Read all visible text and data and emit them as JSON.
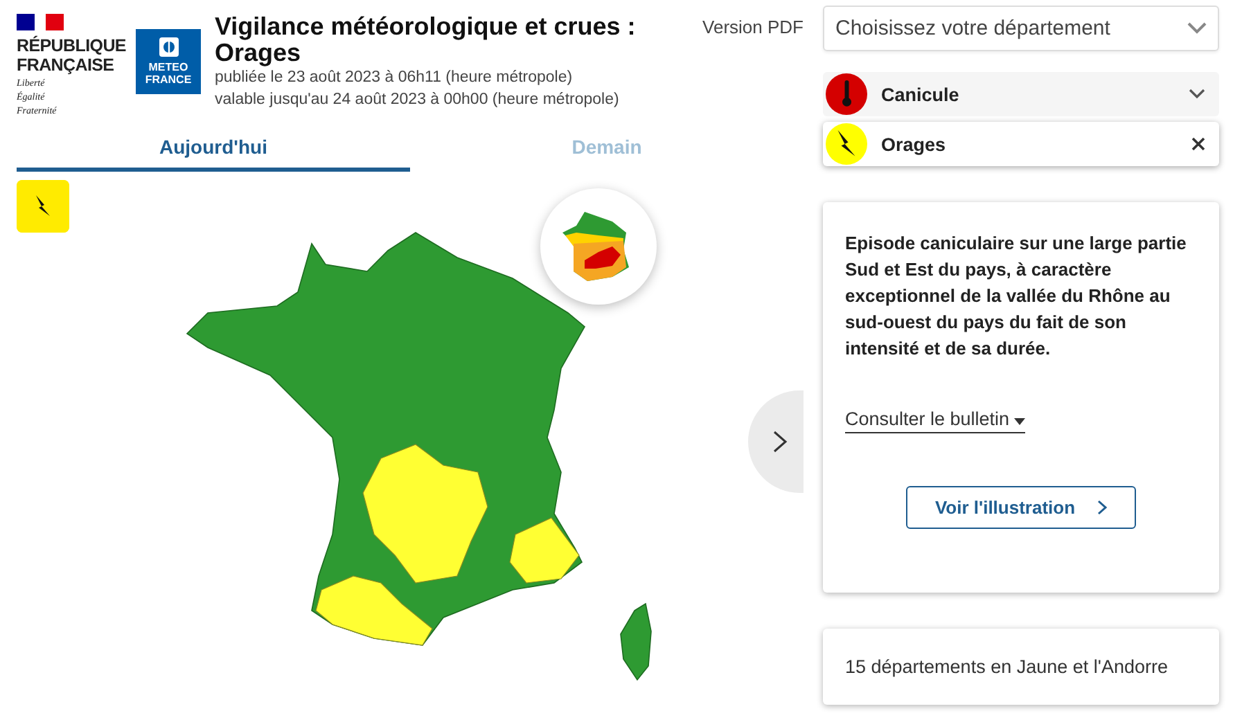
{
  "header": {
    "republic": "RÉPUBLIQUE FRANÇAISE",
    "motto": [
      "Liberté",
      "Égalité",
      "Fraternité"
    ],
    "brand": "METEO FRANCE",
    "title": "Vigilance météorologique et crues : Orages",
    "published": "publiée le 23 août 2023 à 06h11 (heure métropole)",
    "valid": "valable jusqu'au 24 août 2023 à 00h00 (heure métropole)",
    "pdf_link": "Version PDF"
  },
  "tabs": [
    {
      "label": "Aujourd'hui",
      "selected": true
    },
    {
      "label": "Demain",
      "selected": false
    }
  ],
  "department_select": {
    "placeholder": "Choisissez votre département"
  },
  "hazards": [
    {
      "label": "Canicule",
      "kind": "heat",
      "color": "#d40000",
      "selected": false
    },
    {
      "label": "Orages",
      "kind": "storm",
      "color": "#ffff00",
      "selected": true
    }
  ],
  "bulletin": {
    "text": "Episode caniculaire sur une large partie Sud et Est du pays, à caractère exceptionnel de la vallée du Rhône au sud-ouest du pays du fait de son intensité et de sa durée.",
    "link": "Consulter le bulletin",
    "button": "Voir l'illustration"
  },
  "summary": "15 départements en Jaune et l'Andorre"
}
